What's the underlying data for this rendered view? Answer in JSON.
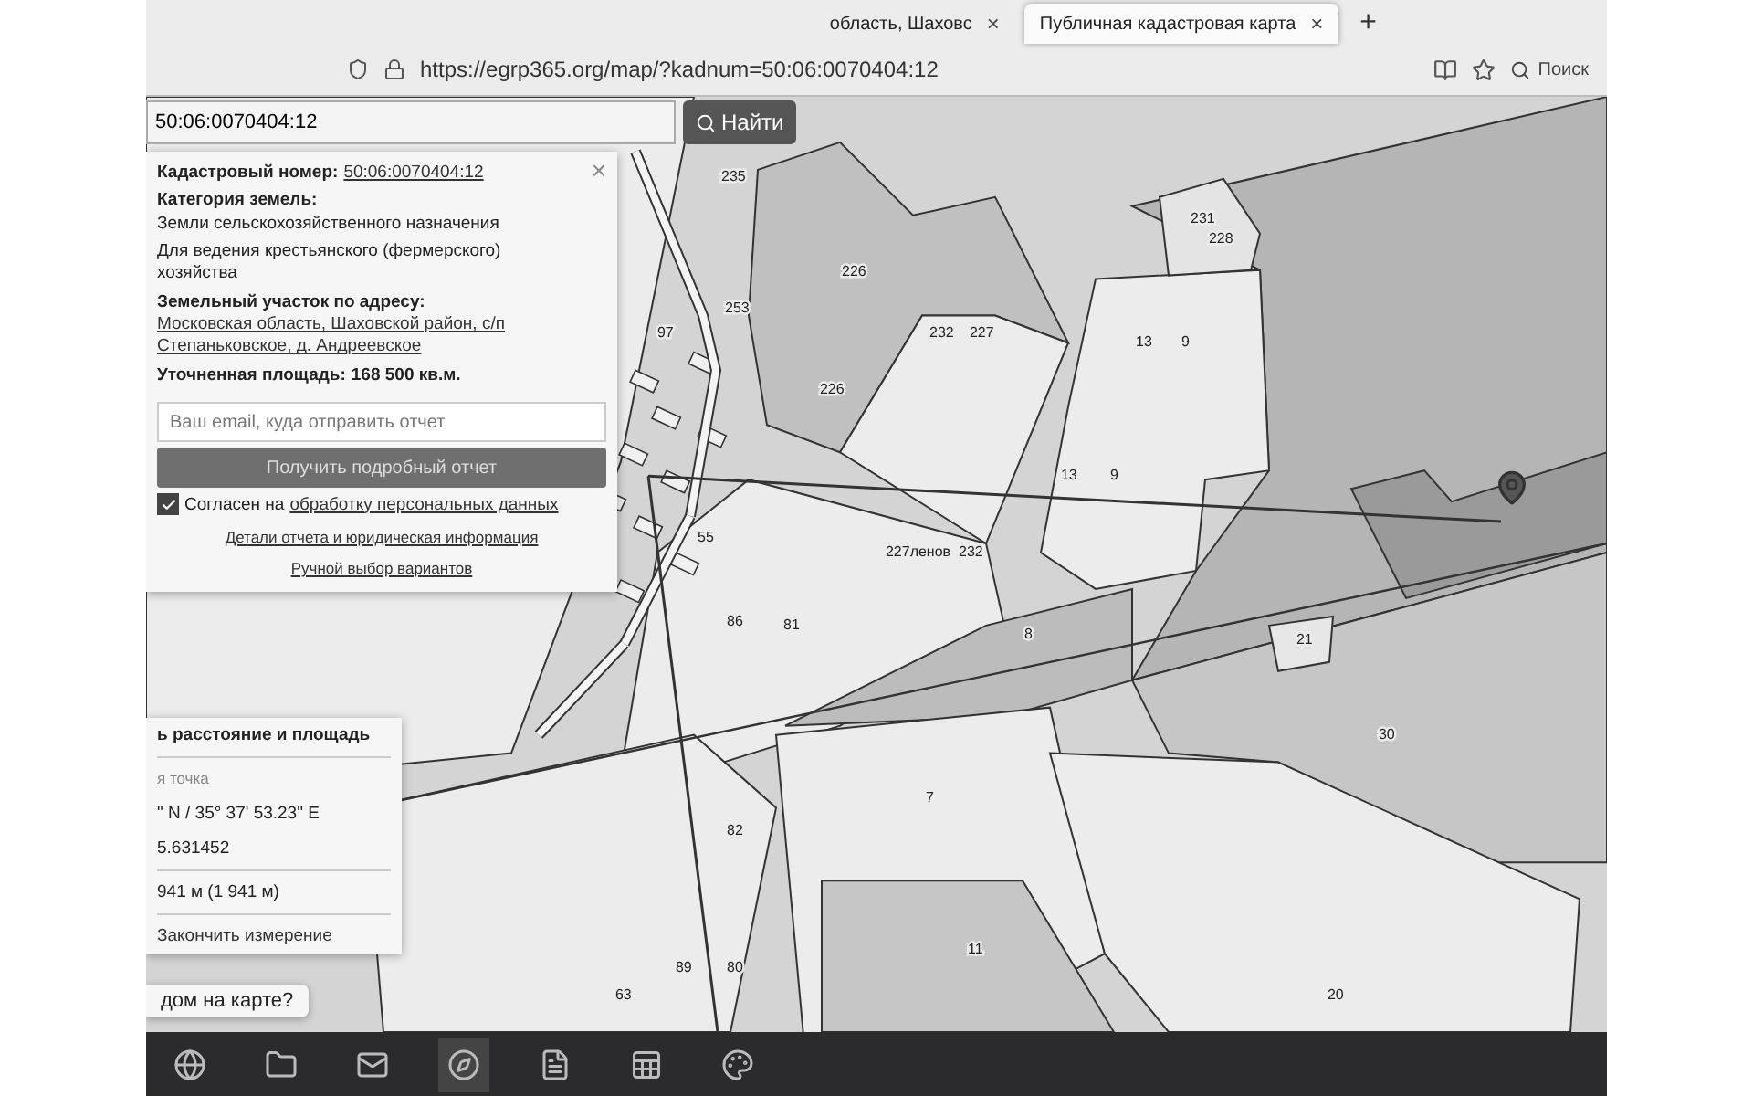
{
  "browser": {
    "tabs": [
      {
        "title": "область, Шаховс",
        "close": "×",
        "selected": false
      },
      {
        "title": "Публичная кадастровая карта",
        "close": "×",
        "selected": true
      }
    ],
    "new_tab": "+",
    "url": "https://egrp365.org/map/?kadnum=50:06:0070404:12",
    "search_placeholder": "Поиск"
  },
  "map_search": {
    "value": "50:06:0070404:12",
    "button": "Найти"
  },
  "parcel_labels": [
    "235",
    "226",
    "253",
    "97",
    "232",
    "227",
    "226",
    "227ленов",
    "232",
    "231",
    "228",
    "13",
    "9",
    "13",
    "9",
    "55",
    "86",
    "81",
    "8",
    "21",
    "30",
    "7",
    "82",
    "89",
    "80",
    "11",
    "63",
    "20"
  ],
  "info_popup": {
    "close": "×",
    "fields": [
      {
        "label": "Кадастровый номер:",
        "value": "50:06:0070404:12",
        "kind": "link"
      },
      {
        "label": "Категория земель:",
        "value": "Земли сельскохозяйственного назначения",
        "kind": "text"
      },
      {
        "value": "Для ведения крестьянского (фермерского) хозяйства",
        "kind": "plain"
      },
      {
        "label": "Земельный участок по адресу:",
        "value": "Московская область, Шаховской район, с/п Степаньковское, д. Андреевское",
        "kind": "block_link"
      },
      {
        "label": "Уточненная площадь:",
        "value": "168 500 кв.м.",
        "kind": "bold"
      }
    ],
    "email_placeholder": "Ваш email, куда отправить отчет",
    "submit": "Получить подробный отчет",
    "consent": {
      "checked": true,
      "text": "Согласен на",
      "link": "обработку персональных данных"
    },
    "links": [
      "Детали отчета и юридическая информация",
      "Ручной выбор вариантов"
    ]
  },
  "measure_panel": {
    "title": "ь расстояние и площадь",
    "point_label": "я точка",
    "coords": "\" N / 35° 37' 53.23\" E",
    "decimal": "5.631452",
    "distance": "941 м (1 941 м)",
    "finish": "Закончить измерение"
  },
  "help_bubble": "дом на карте?"
}
